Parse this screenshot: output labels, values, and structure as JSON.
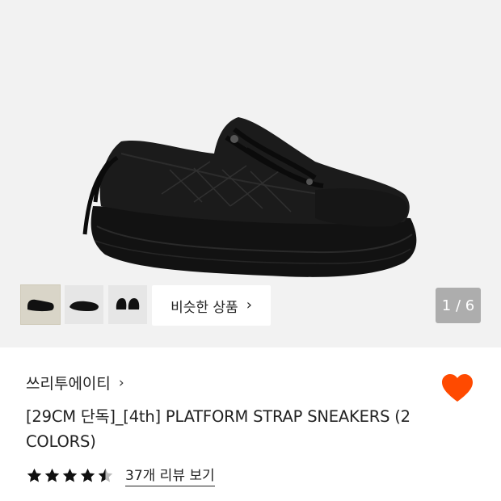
{
  "gallery": {
    "thumbnails": [
      {
        "icon": "shoe-side-thumbnail-icon",
        "active": true
      },
      {
        "icon": "shoe-angle-thumbnail-icon",
        "active": false
      },
      {
        "icon": "shoe-front-thumbnail-icon",
        "active": false
      }
    ],
    "similar_products_label": "비슷한 상품",
    "counter": "1 / 6"
  },
  "product": {
    "brand": "쓰리투에이티",
    "title": "[29CM 단독]_[4th] PLATFORM STRAP SNEAKERS (2 COLORS)",
    "rating": 4.5,
    "review_link": "37개 리뷰 보기",
    "wishlist_color": "#ff4a00"
  }
}
